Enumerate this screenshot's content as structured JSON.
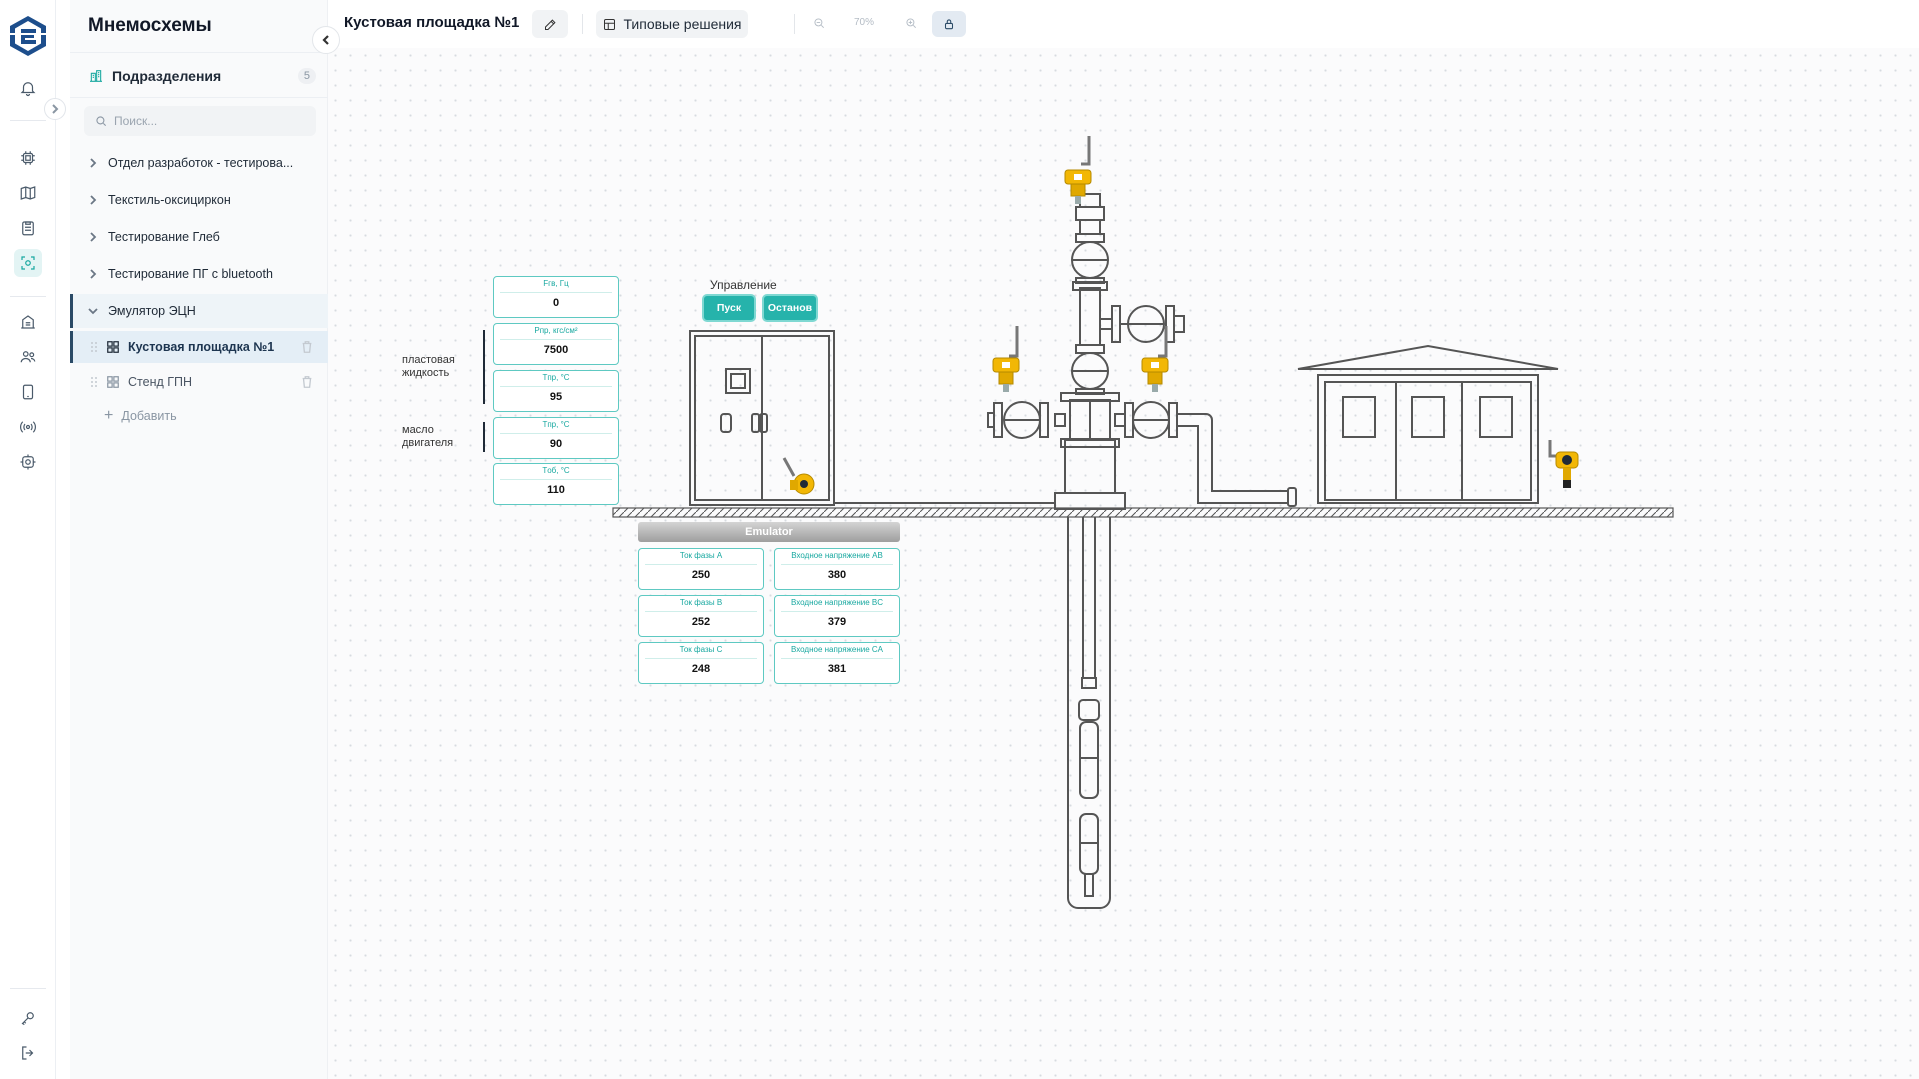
{
  "sidebar": {
    "title": "Мнемосхемы",
    "section": {
      "label": "Подразделения",
      "count": "5"
    },
    "search_placeholder": "Поиск...",
    "groups": [
      {
        "label": "Отдел разработок - тестирова..."
      },
      {
        "label": "Текстиль-оксициркон"
      },
      {
        "label": "Тестирование Глеб"
      },
      {
        "label": "Тестирование ПГ с bluetooth"
      },
      {
        "label": "Эмулятор ЭЦН"
      }
    ],
    "children": [
      {
        "label": "Кустовая площадка №1"
      },
      {
        "label": "Стенд ГПН"
      }
    ],
    "add_label": "Добавить"
  },
  "rail_icons": [
    "logo-icon",
    "bell-icon",
    "chip-icon",
    "map-icon",
    "clipboard-icon",
    "scheme-icon",
    "building-icon",
    "users-icon",
    "tablet-icon",
    "signal-icon",
    "settings-icon",
    "key-icon",
    "logout-icon"
  ],
  "toolbar": {
    "title": "Кустовая площадка №1",
    "templates_label": "Типовые решения",
    "zoom": "70%"
  },
  "scheme": {
    "left_values": [
      {
        "label": "Fгв, Гц",
        "value": "0"
      },
      {
        "label": "Рпр, кгс/см²",
        "value": "7500"
      },
      {
        "label": "Tпр, °C",
        "value": "95"
      },
      {
        "label": "Tпр, °C",
        "value": "90"
      },
      {
        "label": "Tоб, °C",
        "value": "110"
      }
    ],
    "fluid_label": "пластовая жидкость",
    "oil_label": "масло двигателя",
    "control_label": "Управление",
    "start_label": "Пуск",
    "stop_label": "Останов",
    "emulator_label": "Emulator",
    "bottom_values": [
      {
        "label": "Ток фазы A",
        "value": "250"
      },
      {
        "label": "Входное напряжение AB",
        "value": "380"
      },
      {
        "label": "Ток фазы B",
        "value": "252"
      },
      {
        "label": "Входное напряжение BC",
        "value": "379"
      },
      {
        "label": "Ток фазы C",
        "value": "248"
      },
      {
        "label": "Входное напряжение CA",
        "value": "381"
      }
    ]
  },
  "colors": {
    "accent": "#18a8a0",
    "sensor": "#f2b705",
    "navy": "#2a4a66"
  }
}
